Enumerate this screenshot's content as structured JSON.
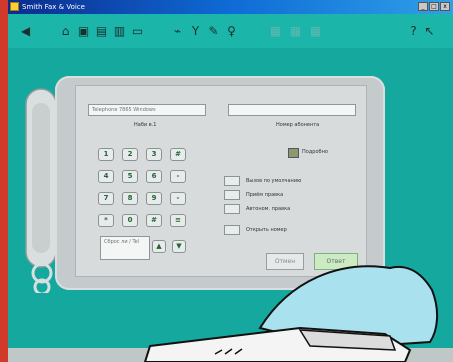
{
  "window": {
    "title": "Smith Fax & Voice"
  },
  "toolbar": {
    "icons": [
      "back-arrow-icon",
      "home-icon",
      "folder-icon",
      "printer-icon",
      "phone-book-icon",
      "monitor-icon",
      "signal-icon",
      "antenna-icon",
      "tools-icon",
      "microphone-icon",
      "help-icon"
    ]
  },
  "dialer": {
    "phone_field": "Telephone 7865 Windows",
    "phone_label": "Наби в.1",
    "number_field": "",
    "number_label": "Номер абонента",
    "checkbox_label": "Подробно",
    "keypad": [
      "1",
      "2",
      "3",
      "#",
      "4",
      "5",
      "6",
      "-",
      "7",
      "8",
      "9",
      "-",
      "*",
      "0",
      "#",
      "≡"
    ],
    "bottom_left": "Сброс ли / Tel",
    "actions": [
      "Вызов по умолчанию",
      "Приём правка",
      "Автоном. правка",
      "Открыть номер"
    ],
    "cancel_label": "Отмен",
    "ok_label": "Ответ"
  },
  "colors": {
    "background": "#14a89e",
    "titlebar": "#0c2b8e",
    "side_strip": "#d13a2a"
  }
}
